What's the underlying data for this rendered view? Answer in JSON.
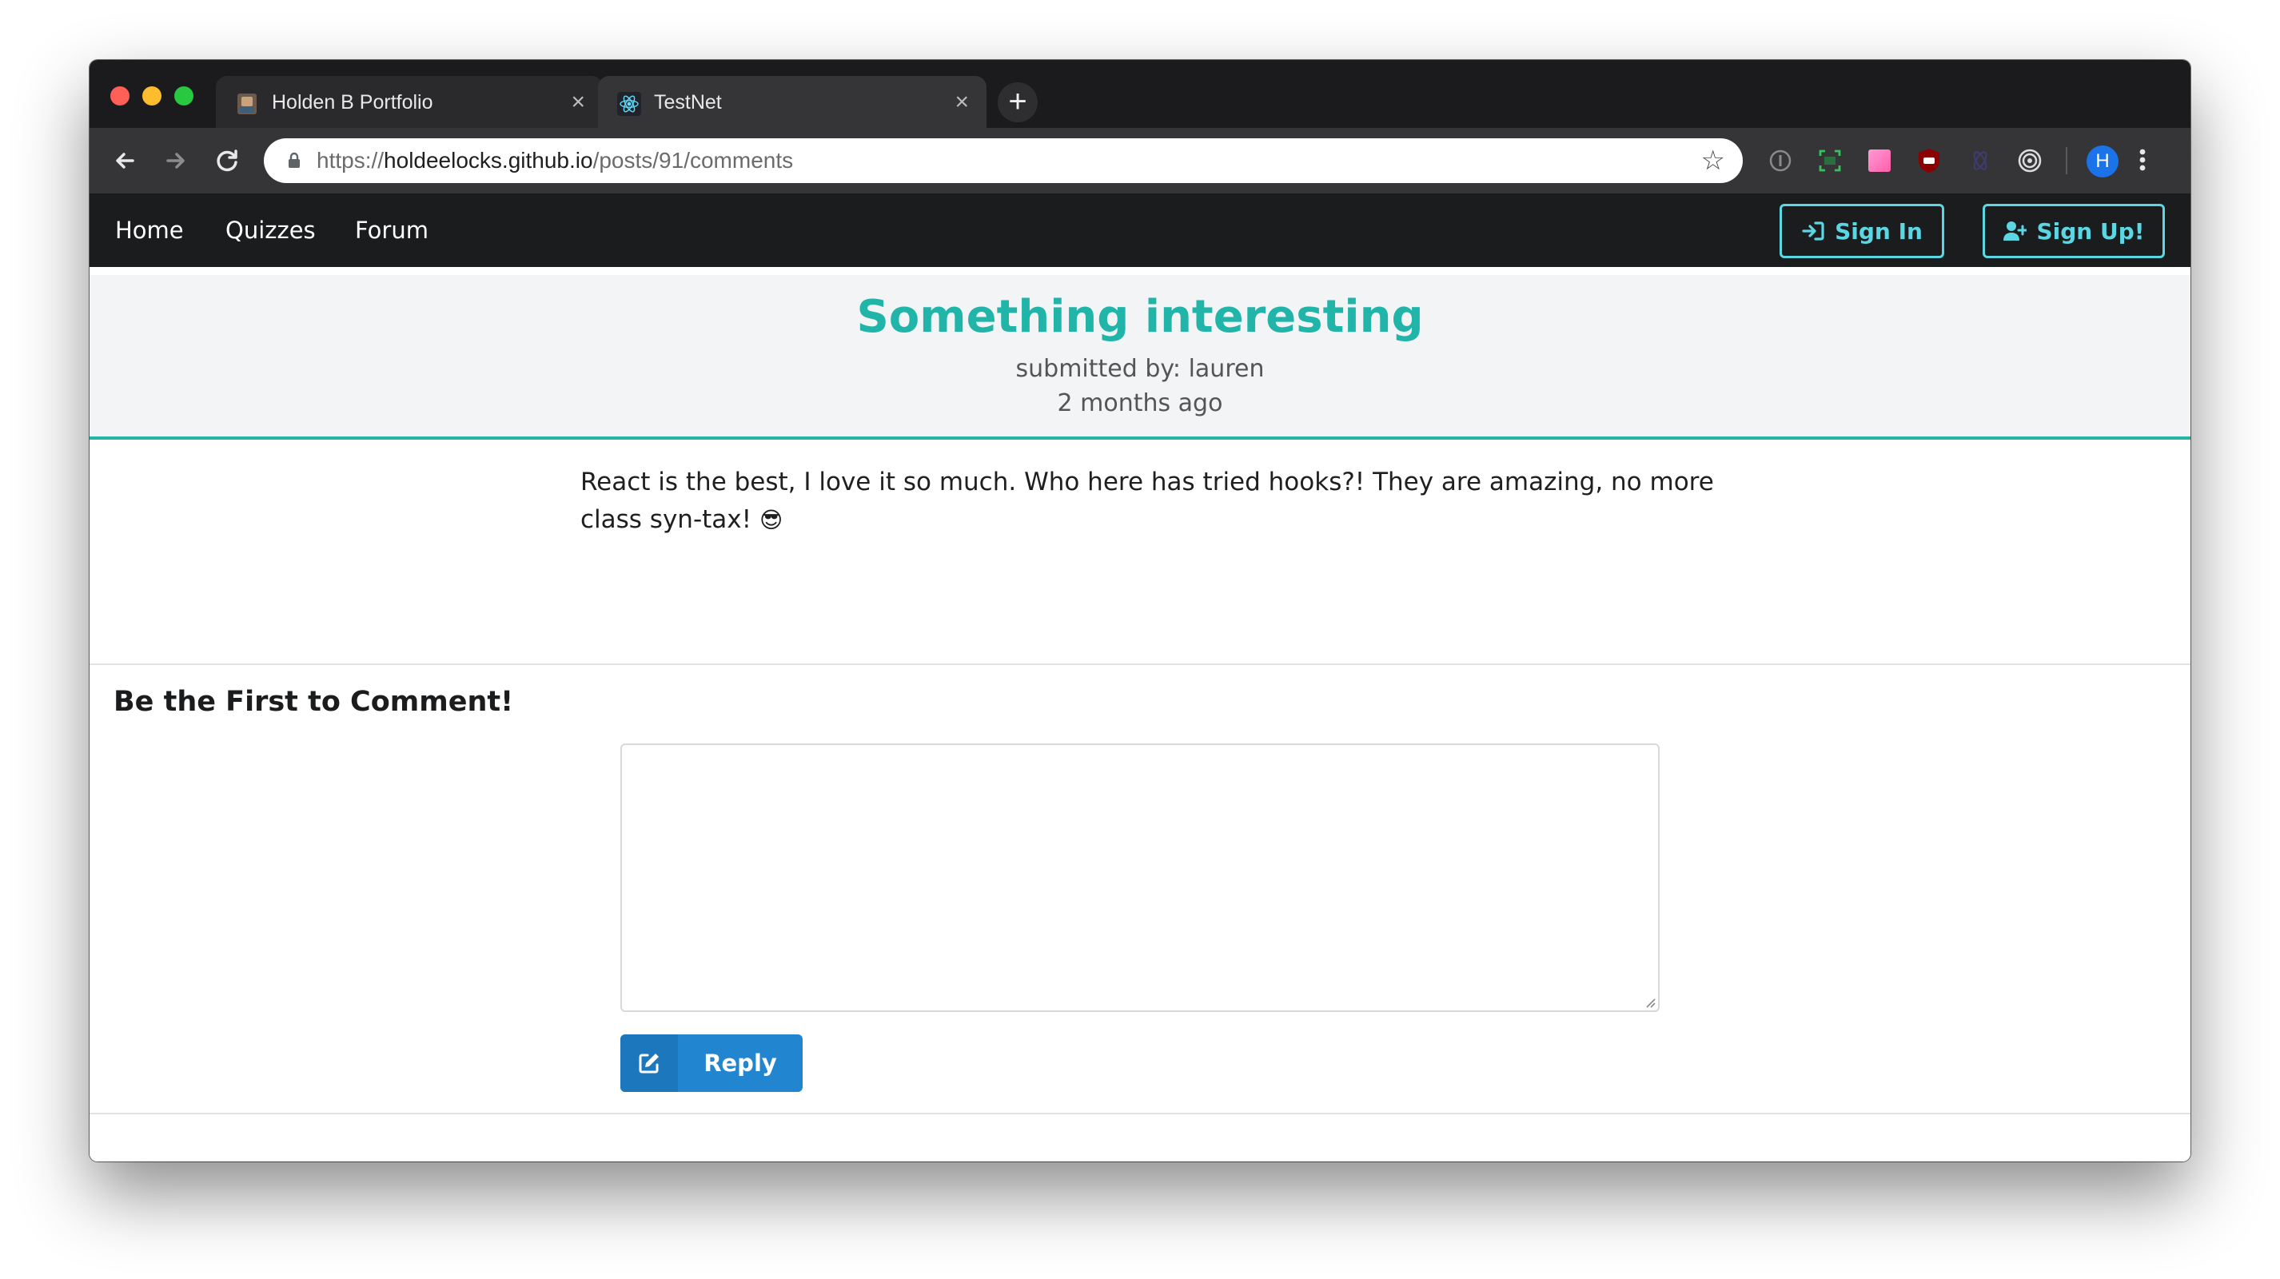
{
  "browser": {
    "tabs": [
      {
        "title": "Holden B Portfolio",
        "active": false
      },
      {
        "title": "TestNet",
        "active": true
      }
    ],
    "new_tab_symbol": "+",
    "url": {
      "scheme": "https://",
      "host": "holdeelocks.github.io",
      "path": "/posts/91/comments"
    },
    "profile_initial": "H",
    "icons": {
      "back": "arrow-left-icon",
      "forward": "arrow-right-icon",
      "reload": "reload-icon",
      "lock": "lock-icon",
      "bookmark": "star-icon",
      "menu": "vertical-dots-icon"
    }
  },
  "site": {
    "nav": {
      "links": [
        "Home",
        "Quizzes",
        "Forum"
      ],
      "sign_in": "Sign In",
      "sign_up": "Sign Up!"
    },
    "post": {
      "title": "Something interesting",
      "submitted_by": "submitted by: lauren",
      "date": "2 months ago",
      "body": "React is the best, I love it so much. Who here has tried hooks?! They are amazing, no more class syn-tax!",
      "emoji": "😎"
    },
    "comments": {
      "heading": "Be the First to Comment!",
      "textarea_value": "",
      "reply_label": "Reply"
    }
  },
  "colors": {
    "accent": "#21b5a9",
    "auth_outline": "#5cd6e2",
    "reply_button": "#2185d0",
    "nav_bg": "#1b1c1d"
  }
}
